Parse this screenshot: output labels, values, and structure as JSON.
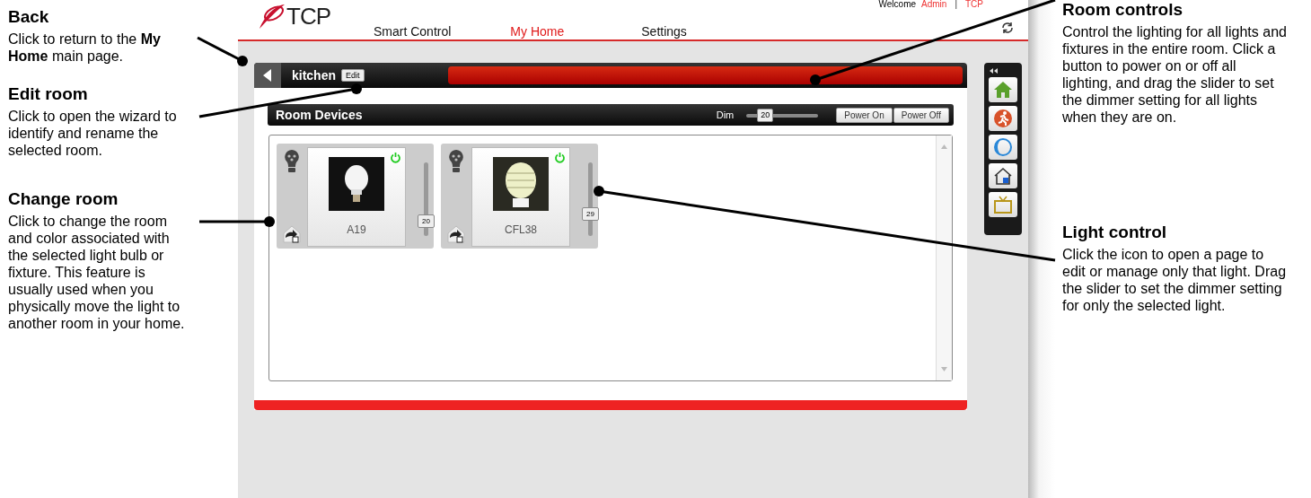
{
  "left_notes": [
    {
      "title": "Back",
      "body": "Click to return to the **My Home** main page."
    },
    {
      "title": "Edit room",
      "body": "Click to open the wizard to identify and rename the selected room."
    },
    {
      "title": "Change room",
      "body": "Click to change the room and color associated with the selected light bulb or fixture. This feature is usually used when you physically move the light to another room in your home."
    }
  ],
  "app": {
    "logo": "TCP",
    "welcome": "Welcome",
    "user": "Admin",
    "separator": "|",
    "account": "TCP",
    "nav": [
      {
        "label": "Smart Control",
        "selected": false
      },
      {
        "label": "My Home",
        "selected": true
      },
      {
        "label": "Settings",
        "selected": false
      }
    ],
    "room": {
      "name": "kitchen",
      "edit": "Edit"
    },
    "devices_bar": {
      "title": "Room Devices",
      "dim_label": "Dim",
      "dim_value": "20",
      "level": 0.2,
      "buttons": [
        "Power On",
        "Power Off"
      ]
    },
    "devices": [
      {
        "name": "A19",
        "on": true,
        "value": "20",
        "level": 0.2,
        "kind": "bulb"
      },
      {
        "name": "CFL38",
        "on": true,
        "value": "29",
        "level": 0.29,
        "kind": "spiral"
      }
    ],
    "sidebar": [
      {
        "kind": "home"
      },
      {
        "kind": "exit"
      },
      {
        "kind": "theme"
      },
      {
        "kind": "room"
      },
      {
        "kind": "tv"
      }
    ]
  },
  "right_notes": [
    {
      "title": "Room controls",
      "body": "Control the lighting for all lights and fixtures in the entire room. Click a button to power on or off all lighting, and drag the slider to set the dimmer setting for all lights when they are on."
    },
    {
      "title": "Light control",
      "body": "Click the icon to open a page to edit or manage only that light. Drag the slider to set the dimmer setting for only the selected light."
    }
  ]
}
